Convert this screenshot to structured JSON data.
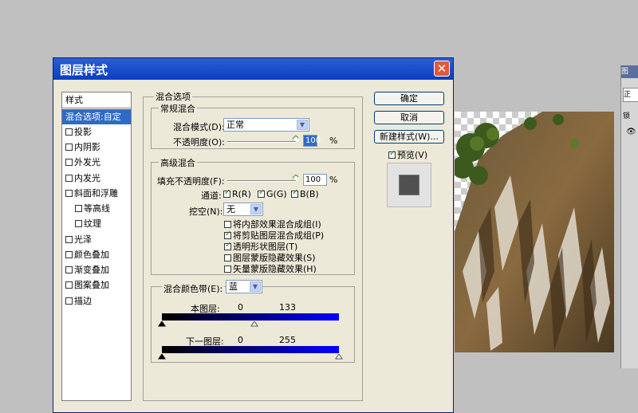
{
  "dialog": {
    "title": "图层样式",
    "close_glyph": "✕"
  },
  "style_list": {
    "header": "样式",
    "items": [
      {
        "label": "混合选项:自定",
        "selected": true,
        "checkbox": false
      },
      {
        "label": "投影",
        "checkbox": true
      },
      {
        "label": "内阴影",
        "checkbox": true
      },
      {
        "label": "外发光",
        "checkbox": true
      },
      {
        "label": "内发光",
        "checkbox": true
      },
      {
        "label": "斜面和浮雕",
        "checkbox": true
      },
      {
        "label": "等高线",
        "checkbox": true,
        "indent": true
      },
      {
        "label": "纹理",
        "checkbox": true,
        "indent": true
      },
      {
        "label": "光泽",
        "checkbox": true
      },
      {
        "label": "颜色叠加",
        "checkbox": true
      },
      {
        "label": "渐变叠加",
        "checkbox": true
      },
      {
        "label": "图案叠加",
        "checkbox": true
      },
      {
        "label": "描边",
        "checkbox": true
      }
    ]
  },
  "blend_options": {
    "section_title": "混合选项",
    "general": {
      "title": "常规混合",
      "mode_label": "混合模式(D):",
      "mode_value": "正常",
      "opacity_label": "不透明度(O):",
      "opacity_value": "100",
      "percent": "%"
    },
    "advanced": {
      "title": "高级混合",
      "fill_label": "填充不透明度(F):",
      "fill_value": "100",
      "percent": "%",
      "channels_label": "通道:",
      "channel_r": "R(R)",
      "channel_g": "G(G)",
      "channel_b": "B(B)",
      "knockout_label": "挖空(N):",
      "knockout_value": "无",
      "options": [
        {
          "label": "将内部效果混合成组(I)",
          "checked": false
        },
        {
          "label": "将剪贴图层混合成组(P)",
          "checked": true
        },
        {
          "label": "透明形状图层(T)",
          "checked": true
        },
        {
          "label": "图层蒙版隐藏效果(S)",
          "checked": false
        },
        {
          "label": "矢量蒙版隐藏效果(H)",
          "checked": false
        }
      ]
    },
    "blend_if": {
      "label": "混合颜色带(E):",
      "value": "蓝",
      "this_layer_label": "本图层:",
      "this_layer_low": "0",
      "this_layer_high": "133",
      "underlying_label": "下一图层:",
      "underlying_low": "0",
      "underlying_high": "255"
    }
  },
  "buttons": {
    "ok": "确定",
    "cancel": "取消",
    "new_style": "新建样式(W)...",
    "preview_label": "预览(V)"
  },
  "side_panel": {
    "title": "图",
    "tab": "正",
    "lock": "锁"
  },
  "colors": {
    "accent": "#316ac5",
    "title_bar": "#0a3ec0",
    "blend_blue": "#0000ff"
  }
}
